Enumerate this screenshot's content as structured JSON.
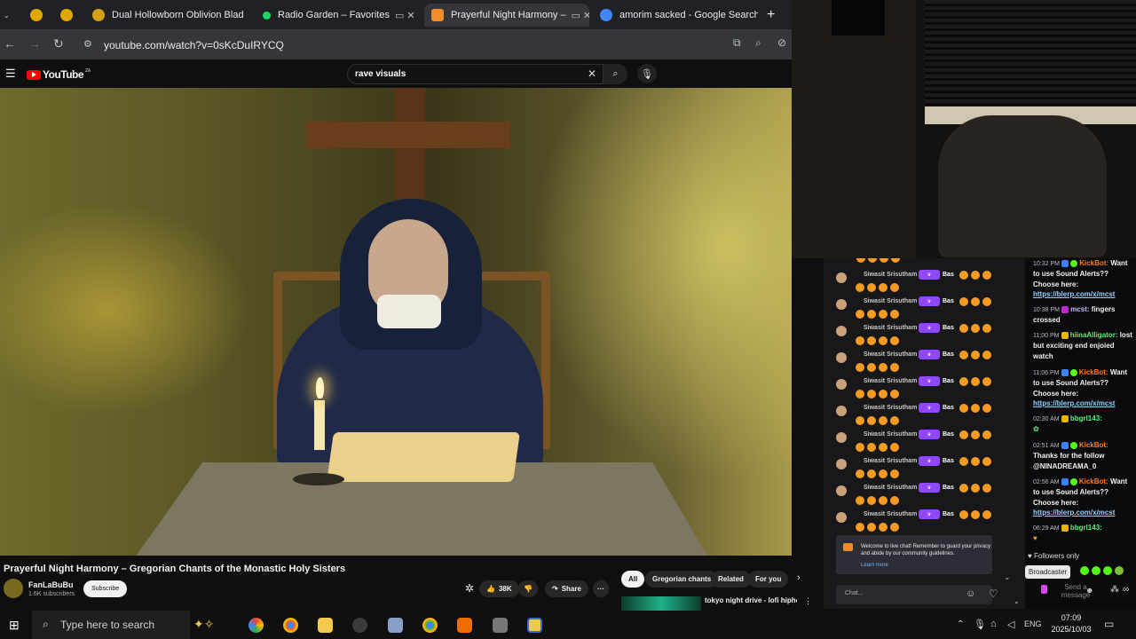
{
  "browser": {
    "tabs": [
      {
        "label": ""
      },
      {
        "label": ""
      },
      {
        "label": "Dual Hollowborn Oblivion Blad"
      },
      {
        "label": "Radio Garden – Favorites"
      },
      {
        "label": "Prayerful Night Harmony –"
      },
      {
        "label": "amorim sacked - Google Search"
      }
    ],
    "url": "youtube.com/watch?v=0sKcDuIRYCQ"
  },
  "youtube": {
    "logo": "YouTube",
    "logo_country": "ZA",
    "search_value": "rave visuals",
    "video_title": "Prayerful Night Harmony – Gregorian Chants of the Monastic Holy Sisters",
    "channel_name": "FanLaBuBu",
    "channel_subs": "1.6K subscribers",
    "subscribe_label": "Subscribe",
    "likes": "38K",
    "share_label": "Share",
    "filter_pills": [
      "All",
      "Gregorian chants",
      "Related",
      "For you"
    ],
    "rec_title": "tokyo night drive - lofi hiphop + chill + beats to"
  },
  "chat_left": {
    "username": "Siwasit Srisutham",
    "message": "Bas",
    "welcome_text": "Welcome to live chat! Remember to guard your privacy and abide by our community guidelines.",
    "learn_more": "Learn more",
    "chat_placeholder": "Chat..."
  },
  "chat_right": {
    "messages": [
      {
        "time": "10:32 PM",
        "user": "KickBot:",
        "text": "Want to use Sound Alerts?? Choose here:",
        "link": "https://blerp.com/x/mcst"
      },
      {
        "time": "10:38 PM",
        "user": "mcst:",
        "text": "fingers crossed"
      },
      {
        "time": "11:00 PM",
        "user": "hiinaAlligator:",
        "text": "lost but exciting end enjoied watch"
      },
      {
        "time": "11:06 PM",
        "user": "KickBot:",
        "text": "Want to use Sound Alerts?? Choose here:",
        "link": "https://blerp.com/x/mcst"
      },
      {
        "time": "02:30 AM",
        "user": "bbgrl143:",
        "text": ""
      },
      {
        "time": "02:51 AM",
        "user": "KickBot:",
        "text": "Thanks for the follow @NINADREAMA_0"
      },
      {
        "time": "02:56 AM",
        "user": "KickBot:",
        "text": "Want to use Sound Alerts?? Choose here:",
        "link": "https://blerp.com/x/mcst"
      },
      {
        "time": "06:29 AM",
        "user": "bbgrl143:",
        "text": ""
      }
    ],
    "followers_only": "Followers only",
    "broadcaster": "Broadcaster",
    "send_placeholder": "Send a message"
  },
  "taskbar": {
    "search_placeholder": "Type here to search",
    "language": "ENG",
    "time": "07:09",
    "date": "2025/10/03"
  },
  "colors": {
    "youtube_red": "#ff0000",
    "kick_green": "#53fc18",
    "twitch_purple": "#9146ff",
    "heart_orange": "#f59a23"
  }
}
